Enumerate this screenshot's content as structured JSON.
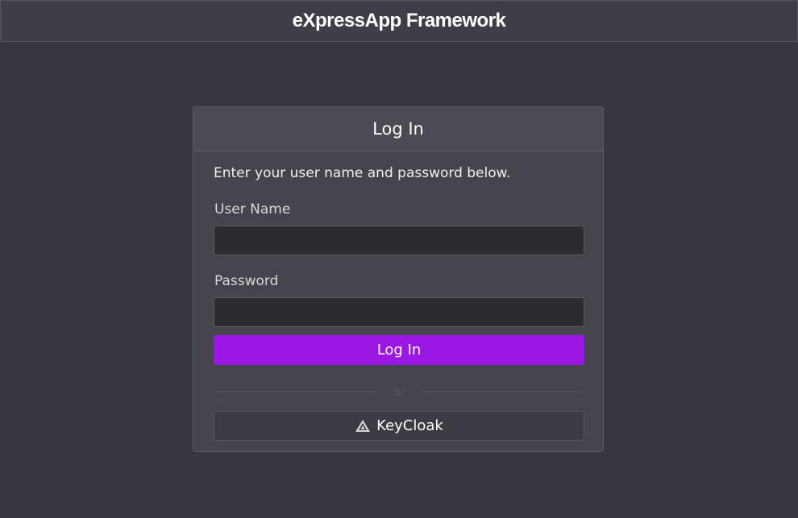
{
  "app": {
    "title": "eXpressApp Framework"
  },
  "login": {
    "title": "Log In",
    "instructions": "Enter your user name and password below.",
    "username_label": "User Name",
    "username_value": "",
    "password_label": "Password",
    "password_value": "",
    "submit_label": "Log In",
    "separator_text": "or",
    "external_provider_label": "KeyCloak",
    "external_provider_icon": "keycloak-icon"
  },
  "colors": {
    "background": "#383641",
    "card": "#45434c",
    "accent": "#9b17e3",
    "input_bg": "#2d2b32"
  }
}
